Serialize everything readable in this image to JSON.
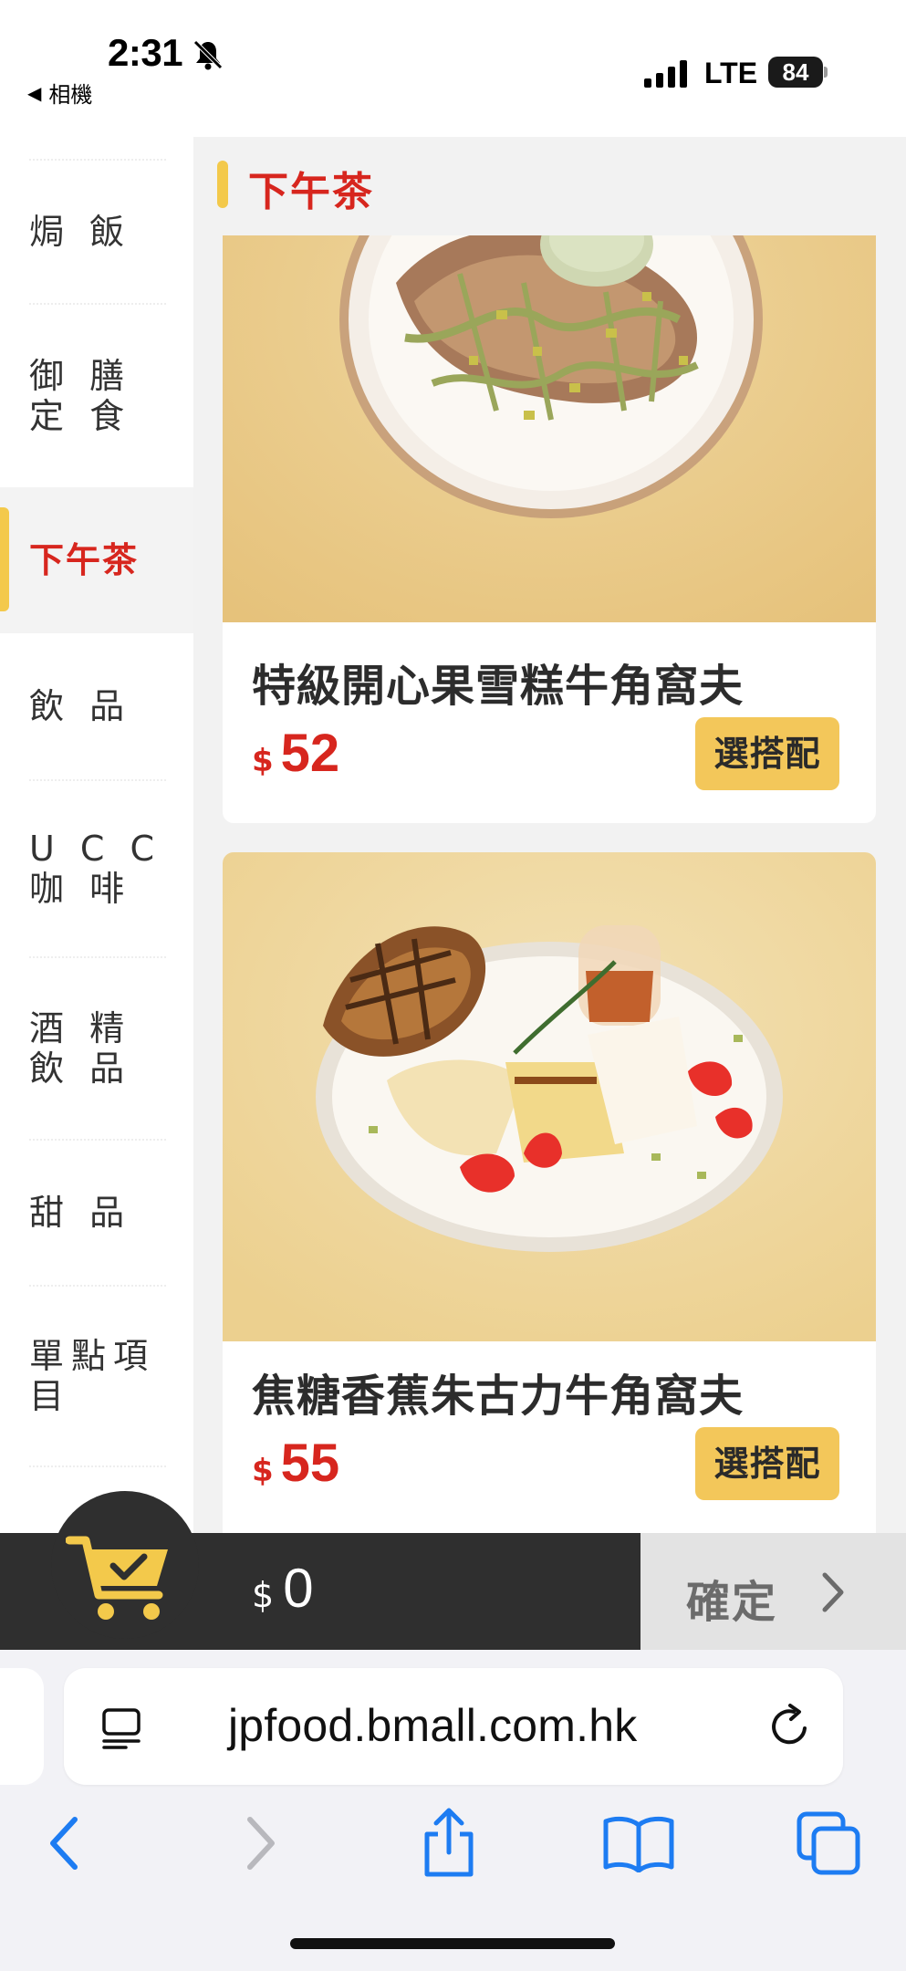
{
  "status_bar": {
    "time": "2:31",
    "back_app_label": "相機",
    "network": "LTE",
    "battery": "84",
    "icons": [
      "silent-mode-icon",
      "signal-icon",
      "battery-icon"
    ]
  },
  "sidebar": {
    "items": [
      {
        "label": "焗 飯",
        "active": false
      },
      {
        "label": "御 膳\n定 食",
        "active": false
      },
      {
        "label": "下午茶",
        "active": true
      },
      {
        "label": "飲 品",
        "active": false
      },
      {
        "label": "U C C\n   咖 啡",
        "active": false
      },
      {
        "label": "酒 精\n飲 品",
        "active": false
      },
      {
        "label": "甜 品",
        "active": false
      },
      {
        "label": "單點項\n目",
        "active": false
      }
    ],
    "active_color": "#d7261e",
    "accent_color": "#f3c94b"
  },
  "section": {
    "title": "下午茶"
  },
  "products": [
    {
      "name": "特級開心果雪糕牛角窩夫",
      "currency": "$",
      "price": "52",
      "button": "選搭配",
      "image_icon": "pistachio-croffle-image"
    },
    {
      "name": "焦糖香蕉朱古力牛角窩夫",
      "currency": "$",
      "price": "55",
      "button": "選搭配",
      "image_icon": "banana-croffle-image"
    }
  ],
  "cart": {
    "currency": "$",
    "total": "0",
    "confirm_label": "確定",
    "icon": "cart-check-icon"
  },
  "browser": {
    "url": "jpfood.bmall.com.hk",
    "icons": [
      "reader-icon",
      "reload-icon",
      "back-arrow-icon",
      "forward-arrow-icon",
      "share-icon",
      "bookmarks-icon",
      "tabs-icon"
    ]
  }
}
